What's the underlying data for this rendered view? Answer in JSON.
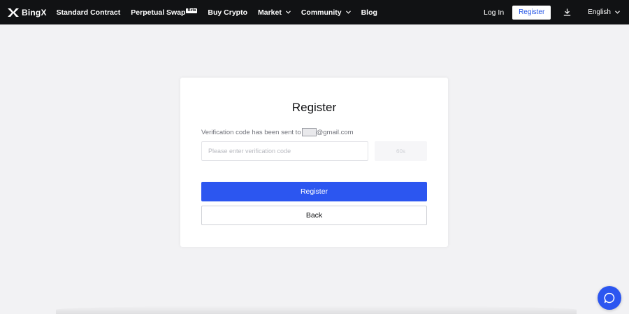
{
  "brand": {
    "name": "BingX"
  },
  "nav": {
    "items": [
      {
        "label": "Standard Contract"
      },
      {
        "label": "Perpetual Swap",
        "badge": "Beta"
      },
      {
        "label": "Buy Crypto"
      },
      {
        "label": "Market"
      },
      {
        "label": "Community"
      },
      {
        "label": "Blog"
      }
    ],
    "login_label": "Log In",
    "register_label": "Register",
    "language": "English"
  },
  "register_form": {
    "title": "Register",
    "sent_prefix": "Verification code has been sent to",
    "sent_suffix": "@gmail.com",
    "code_placeholder": "Please enter verification code",
    "code_value": "",
    "send_label": "60s",
    "submit_label": "Register",
    "back_label": "Back"
  },
  "colors": {
    "navbar": "#111214",
    "primary": "#2c56f0",
    "background": "#f2f2f4"
  },
  "icons": {
    "logo": "bingx-logo-icon",
    "download": "download-icon",
    "chat": "chat-bubble-icon",
    "dropdown": "chevron-down-icon"
  }
}
